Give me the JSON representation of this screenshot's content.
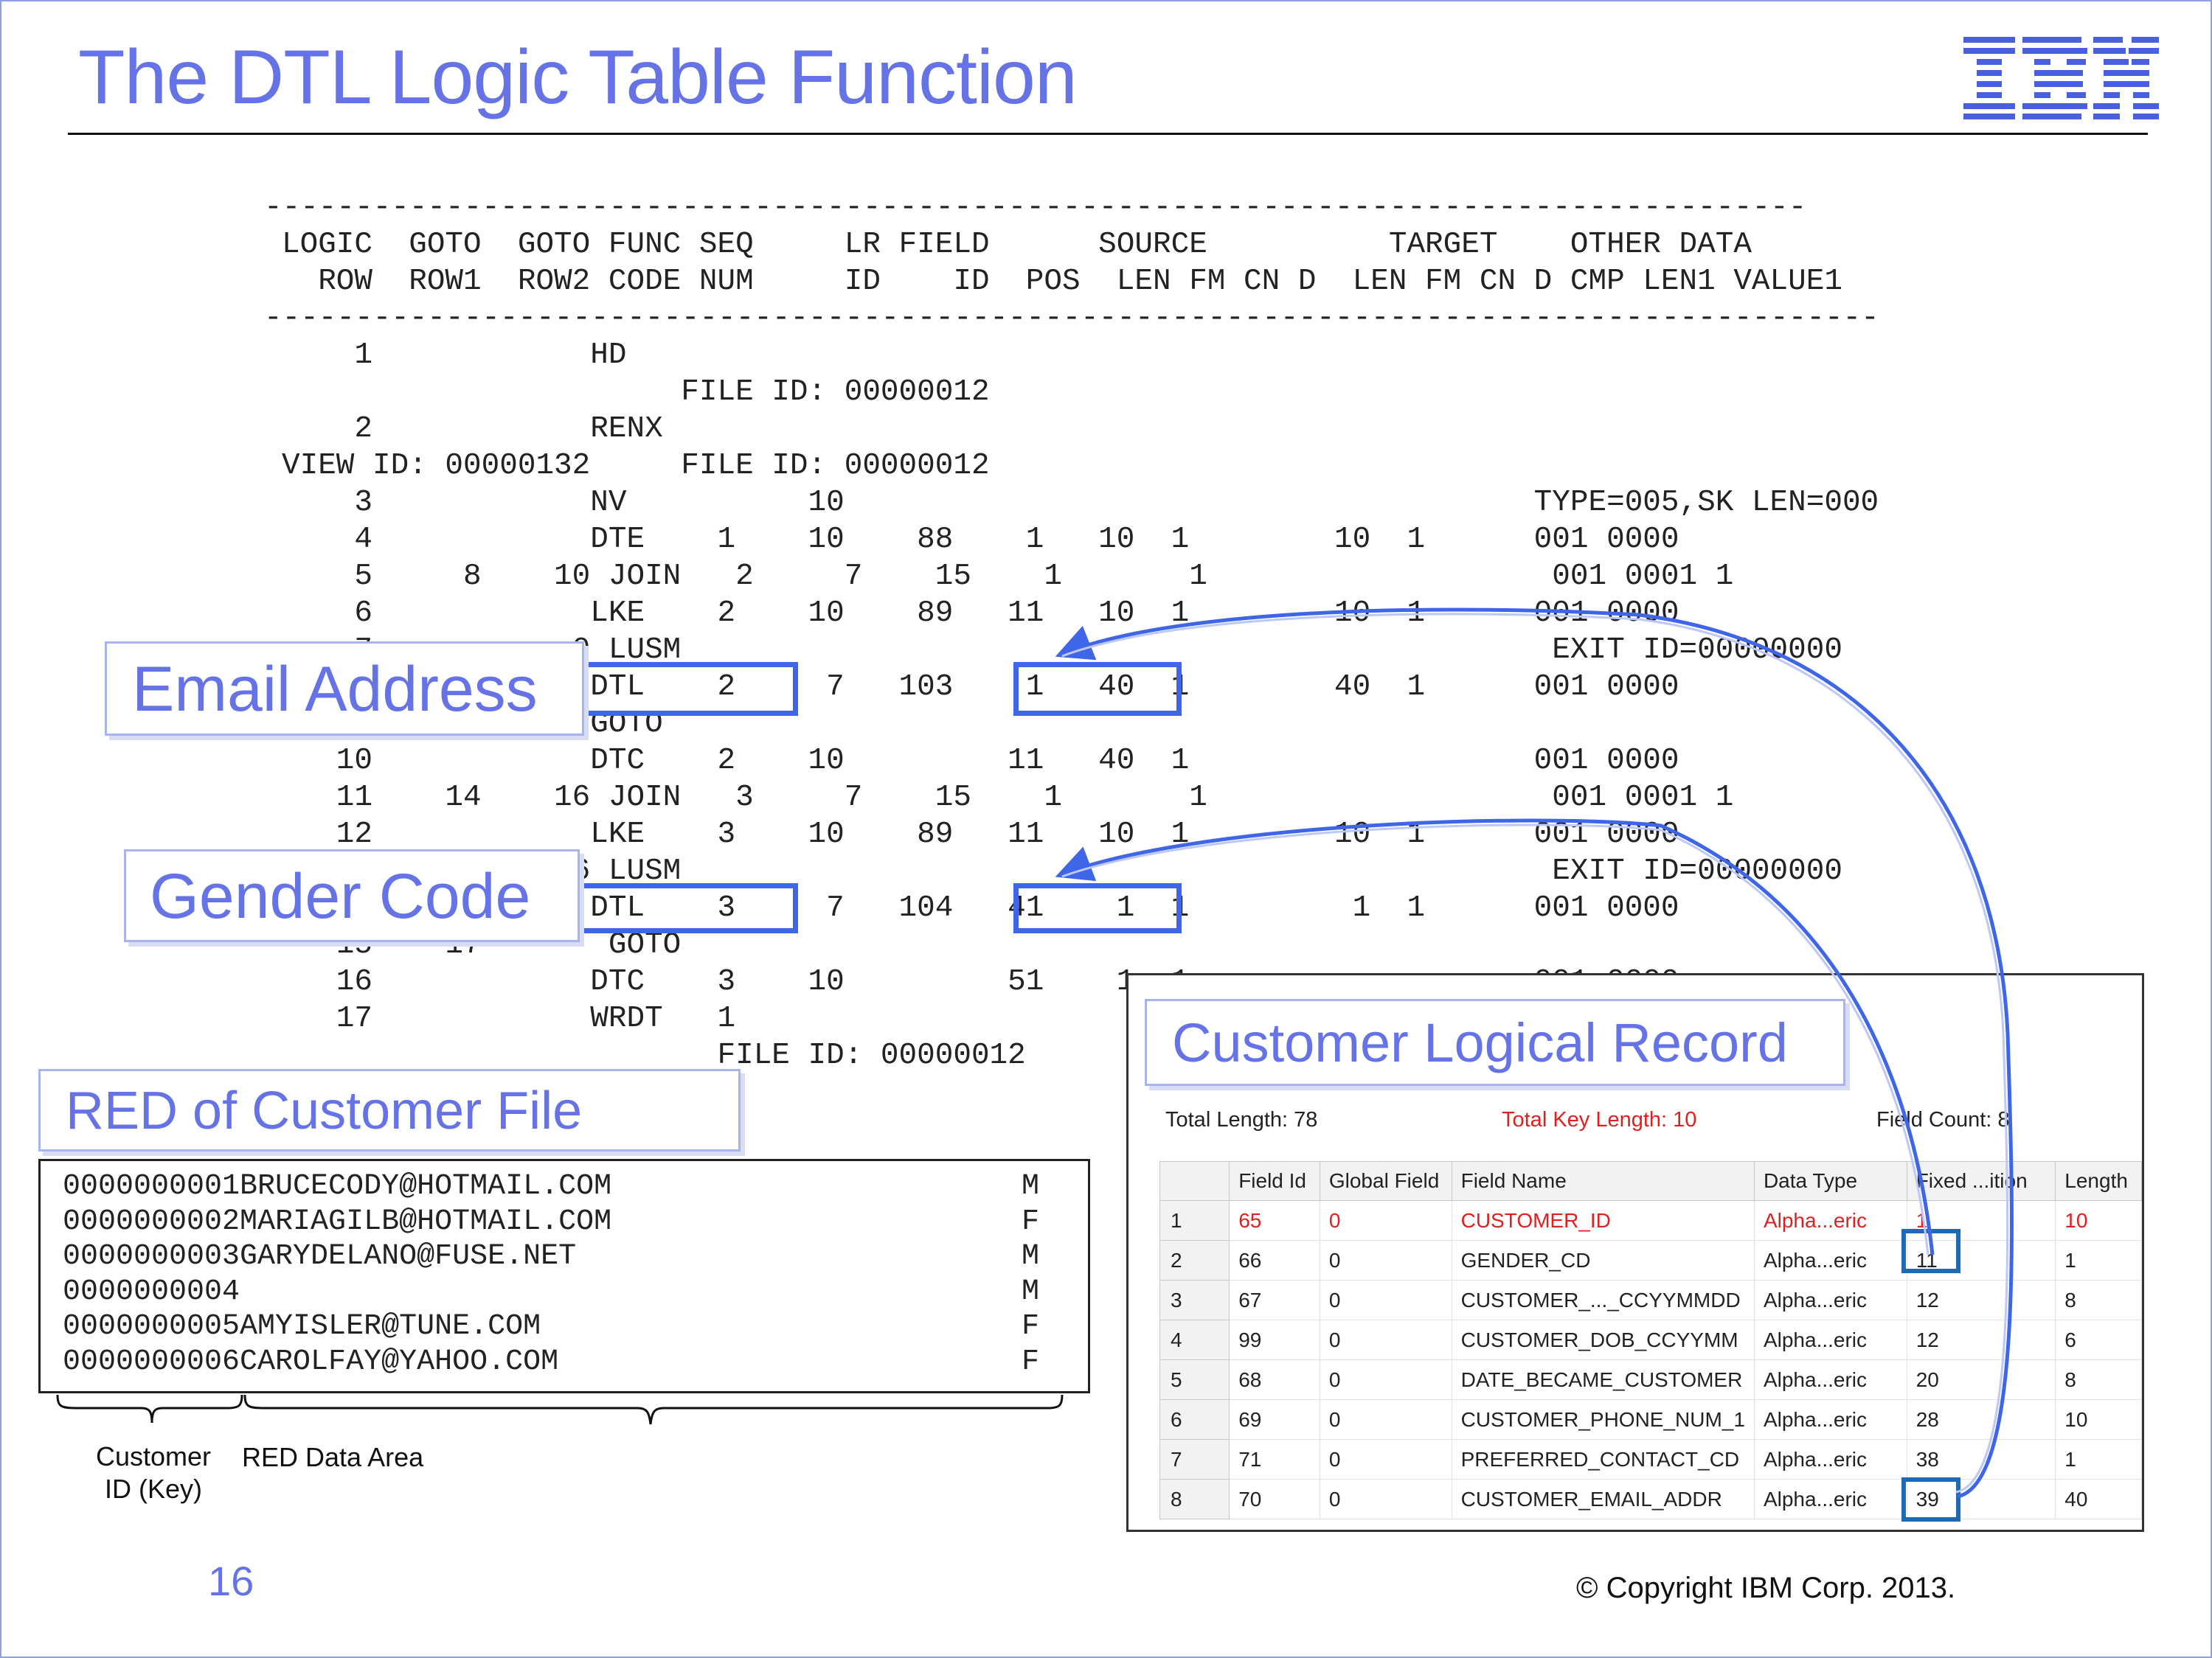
{
  "title": "The DTL Logic Table Function",
  "logo": {
    "text": "IBM",
    "icon": "ibm-logo"
  },
  "listing": {
    "dash_top": "-------------------------------------------------------------------------------------",
    "header1": "LOGIC  GOTO  GOTO FUNC SEQ     LR FIELD      SOURCE          TARGET    OTHER DATA",
    "header2": "  ROW  ROW1  ROW2 CODE NUM     ID    ID  POS  LEN FM CN D  LEN FM CN D CMP LEN1 VALUE1",
    "dash_bottom": "-----------------------------------------------------------------------------------------",
    "rows": [
      "    1            HD",
      "                      FILE ID: 00000012",
      "    2            RENX",
      "VIEW ID: 00000132     FILE ID: 00000012",
      "    3            NV          10                                      TYPE=005,SK LEN=000",
      "    4            DTE    1    10    88    1   10  1        10  1      001 0000",
      "    5     8    10 JOIN   2     7    15    1       1                   001 0001 1",
      "    6            LKE    2    10    89   11   10  1        10  1      001 0000",
      "    7           0 LUSM                                                EXIT ID=00000000",
      "    8            DTL    2     7   103    1   40  1        40  1      001 0000",
      "    9            GOTO",
      "   10            DTC    2    10         11   40  1                   001 0000",
      "   11    14    16 JOIN   3     7    15    1       1                   001 0001 1",
      "   12            LKE    3    10    89   11   10  1        10  1      001 0000",
      "   13           6 LUSM                                                EXIT ID=00000000",
      "   14            DTL    3     7   104   41    1  1         1  1      001 0000",
      "   15    17       GOTO",
      "   16            DTC    3    10         51    1  1                   001 0000",
      "   17            WRDT   1",
      "                        FILE ID: 00000012"
    ]
  },
  "callouts": {
    "email": "Email Address",
    "gender": "Gender Code",
    "red_file": "RED of Customer File",
    "customer_lr": "Customer Logical  Record"
  },
  "red_file": {
    "records": [
      {
        "data": "0000000001BRUCECODY@HOTMAIL.COM",
        "flag": "M"
      },
      {
        "data": "0000000002MARIAGILB@HOTMAIL.COM",
        "flag": "F"
      },
      {
        "data": "0000000003GARYDELANO@FUSE.NET",
        "flag": "M"
      },
      {
        "data": "0000000004",
        "flag": "M"
      },
      {
        "data": "0000000005AMYISLER@TUNE.COM",
        "flag": "F"
      },
      {
        "data": "0000000006CAROLFAY@YAHOO.COM",
        "flag": "F"
      }
    ],
    "label_key_line1": "Customer",
    "label_key_line2": "ID (Key)",
    "label_data": "RED Data Area"
  },
  "logical_record": {
    "total_length": "Total Length: 78",
    "total_key_length": "Total Key Length: 10",
    "field_count": "Field Count: 8",
    "columns": [
      "",
      "Field Id",
      "Global Field",
      "Field Name",
      "Data Type",
      "Fixed ...ition",
      "Length"
    ],
    "rows": [
      [
        "1",
        "65",
        "0",
        "CUSTOMER_ID",
        "Alpha...eric",
        "1",
        "10"
      ],
      [
        "2",
        "66",
        "0",
        "GENDER_CD",
        "Alpha...eric",
        "11",
        "1"
      ],
      [
        "3",
        "67",
        "0",
        "CUSTOMER_..._CCYYMMDD",
        "Alpha...eric",
        "12",
        "8"
      ],
      [
        "4",
        "99",
        "0",
        "CUSTOMER_DOB_CCYYMM",
        "Alpha...eric",
        "12",
        "6"
      ],
      [
        "5",
        "68",
        "0",
        "DATE_BECAME_CUSTOMER",
        "Alpha...eric",
        "20",
        "8"
      ],
      [
        "6",
        "69",
        "0",
        "CUSTOMER_PHONE_NUM_1",
        "Alpha...eric",
        "28",
        "10"
      ],
      [
        "7",
        "71",
        "0",
        "PREFERRED_CONTACT_CD",
        "Alpha...eric",
        "38",
        "1"
      ],
      [
        "8",
        "70",
        "0",
        "CUSTOMER_EMAIL_ADDR",
        "Alpha...eric",
        "39",
        "40"
      ]
    ]
  },
  "footer": {
    "page_number": "16",
    "copyright": "© Copyright IBM Corp. 2013."
  },
  "colors": {
    "title": "#6673e6",
    "highlight": "#3f66e8",
    "key_field": "#e02020",
    "cell_highlight": "#1f6ab5"
  }
}
